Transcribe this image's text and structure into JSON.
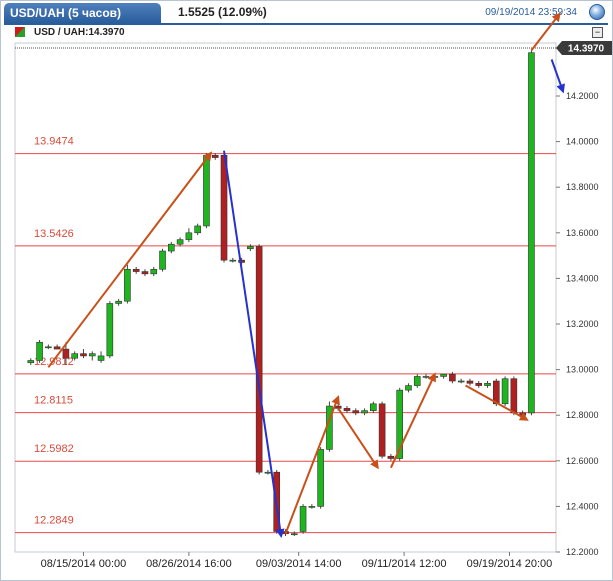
{
  "header": {
    "tab_title": "USD/UAH (5 часов)",
    "change": "1.5525 (12.09%)",
    "datetime": "09/19/2014 23:59:34",
    "symbol_label": "USD / UAH:14.3970",
    "current_price_label": "14.3970",
    "minimize_glyph": "−"
  },
  "chart_data": {
    "type": "candlestick",
    "xlim": [
      0,
      60
    ],
    "ylim": [
      12.2,
      14.45
    ],
    "y_ticks": [
      12.2,
      12.4,
      12.6,
      12.8,
      13.0,
      13.2,
      13.4,
      13.6,
      13.8,
      14.0,
      14.2
    ],
    "y_tick_labels": [
      "12.2000",
      "12.4000",
      "12.6000",
      "12.8000",
      "13.0000",
      "13.2000",
      "13.4000",
      "13.6000",
      "13.8000",
      "14.0000",
      "14.2000"
    ],
    "x_tick_labels": [
      {
        "x": 7,
        "label": "08/15/2014 00:00"
      },
      {
        "x": 19,
        "label": "08/26/2014 16:00"
      },
      {
        "x": 31.5,
        "label": "09/03/2014 14:00"
      },
      {
        "x": 43.5,
        "label": "09/11/2014 12:00"
      },
      {
        "x": 55.5,
        "label": "09/19/2014 20:00"
      }
    ],
    "last_price": 14.397,
    "levels": [
      {
        "value": 13.9474,
        "label": "13.9474"
      },
      {
        "value": 13.5426,
        "label": "13.5426"
      },
      {
        "value": 12.9812,
        "label": "12.9812"
      },
      {
        "value": 12.8115,
        "label": "12.8115"
      },
      {
        "value": 12.5982,
        "label": "12.5982"
      },
      {
        "value": 12.2849,
        "label": "12.2849"
      }
    ],
    "candles": [
      {
        "x": 1,
        "o": 13.03,
        "h": 13.05,
        "l": 13.02,
        "c": 13.04
      },
      {
        "x": 2,
        "o": 13.04,
        "h": 13.13,
        "l": 13.03,
        "c": 13.12
      },
      {
        "x": 3,
        "o": 13.1,
        "h": 13.11,
        "l": 13.09,
        "c": 13.1
      },
      {
        "x": 4,
        "o": 13.1,
        "h": 13.11,
        "l": 13.09,
        "c": 13.09
      },
      {
        "x": 5,
        "o": 13.09,
        "h": 13.12,
        "l": 13.02,
        "c": 13.05
      },
      {
        "x": 6,
        "o": 13.05,
        "h": 13.08,
        "l": 13.04,
        "c": 13.07
      },
      {
        "x": 7,
        "o": 13.07,
        "h": 13.09,
        "l": 13.05,
        "c": 13.06
      },
      {
        "x": 8,
        "o": 13.06,
        "h": 13.08,
        "l": 13.04,
        "c": 13.07
      },
      {
        "x": 9,
        "o": 13.04,
        "h": 13.08,
        "l": 13.03,
        "c": 13.06
      },
      {
        "x": 10,
        "o": 13.06,
        "h": 13.3,
        "l": 13.05,
        "c": 13.29
      },
      {
        "x": 11,
        "o": 13.29,
        "h": 13.31,
        "l": 13.28,
        "c": 13.3
      },
      {
        "x": 12,
        "o": 13.3,
        "h": 13.46,
        "l": 13.29,
        "c": 13.44
      },
      {
        "x": 13,
        "o": 13.44,
        "h": 13.45,
        "l": 13.42,
        "c": 13.43
      },
      {
        "x": 14,
        "o": 13.43,
        "h": 13.44,
        "l": 13.41,
        "c": 13.42
      },
      {
        "x": 15,
        "o": 13.42,
        "h": 13.45,
        "l": 13.41,
        "c": 13.44
      },
      {
        "x": 16,
        "o": 13.44,
        "h": 13.53,
        "l": 13.43,
        "c": 13.52
      },
      {
        "x": 17,
        "o": 13.52,
        "h": 13.56,
        "l": 13.51,
        "c": 13.55
      },
      {
        "x": 18,
        "o": 13.55,
        "h": 13.58,
        "l": 13.54,
        "c": 13.57
      },
      {
        "x": 19,
        "o": 13.57,
        "h": 13.62,
        "l": 13.56,
        "c": 13.6
      },
      {
        "x": 20,
        "o": 13.6,
        "h": 13.64,
        "l": 13.59,
        "c": 13.63
      },
      {
        "x": 21,
        "o": 13.63,
        "h": 13.95,
        "l": 13.62,
        "c": 13.94
      },
      {
        "x": 22,
        "o": 13.94,
        "h": 13.95,
        "l": 13.92,
        "c": 13.93
      },
      {
        "x": 23,
        "o": 13.94,
        "h": 13.95,
        "l": 13.47,
        "c": 13.48
      },
      {
        "x": 24,
        "o": 13.48,
        "h": 13.49,
        "l": 13.47,
        "c": 13.48
      },
      {
        "x": 25,
        "o": 13.48,
        "h": 13.49,
        "l": 13.46,
        "c": 13.47
      },
      {
        "x": 26,
        "o": 13.53,
        "h": 13.55,
        "l": 13.52,
        "c": 13.54
      },
      {
        "x": 27,
        "o": 13.54,
        "h": 13.55,
        "l": 12.54,
        "c": 12.55
      },
      {
        "x": 28,
        "o": 12.55,
        "h": 12.56,
        "l": 12.54,
        "c": 12.55
      },
      {
        "x": 29,
        "o": 12.55,
        "h": 12.56,
        "l": 12.28,
        "c": 12.29
      },
      {
        "x": 30,
        "o": 12.29,
        "h": 12.3,
        "l": 12.27,
        "c": 12.28
      },
      {
        "x": 31,
        "o": 12.28,
        "h": 12.29,
        "l": 12.27,
        "c": 12.28
      },
      {
        "x": 32,
        "o": 12.29,
        "h": 12.41,
        "l": 12.28,
        "c": 12.4
      },
      {
        "x": 33,
        "o": 12.4,
        "h": 12.41,
        "l": 12.39,
        "c": 12.4
      },
      {
        "x": 34,
        "o": 12.4,
        "h": 12.66,
        "l": 12.39,
        "c": 12.65
      },
      {
        "x": 35,
        "o": 12.65,
        "h": 12.86,
        "l": 12.64,
        "c": 12.84
      },
      {
        "x": 36,
        "o": 12.84,
        "h": 12.85,
        "l": 12.82,
        "c": 12.83
      },
      {
        "x": 37,
        "o": 12.83,
        "h": 12.84,
        "l": 12.81,
        "c": 12.82
      },
      {
        "x": 38,
        "o": 12.82,
        "h": 12.83,
        "l": 12.8,
        "c": 12.81
      },
      {
        "x": 39,
        "o": 12.81,
        "h": 12.83,
        "l": 12.8,
        "c": 12.82
      },
      {
        "x": 40,
        "o": 12.82,
        "h": 12.86,
        "l": 12.81,
        "c": 12.85
      },
      {
        "x": 41,
        "o": 12.85,
        "h": 12.86,
        "l": 12.61,
        "c": 12.62
      },
      {
        "x": 42,
        "o": 12.62,
        "h": 12.63,
        "l": 12.6,
        "c": 12.61
      },
      {
        "x": 43,
        "o": 12.61,
        "h": 12.92,
        "l": 12.6,
        "c": 12.91
      },
      {
        "x": 44,
        "o": 12.91,
        "h": 12.94,
        "l": 12.9,
        "c": 12.93
      },
      {
        "x": 45,
        "o": 12.93,
        "h": 12.98,
        "l": 12.92,
        "c": 12.97
      },
      {
        "x": 46,
        "o": 12.97,
        "h": 12.98,
        "l": 12.96,
        "c": 12.97
      },
      {
        "x": 47,
        "o": 12.97,
        "h": 12.98,
        "l": 12.96,
        "c": 12.97
      },
      {
        "x": 48,
        "o": 12.97,
        "h": 12.98,
        "l": 12.96,
        "c": 12.98
      },
      {
        "x": 49,
        "o": 12.98,
        "h": 12.99,
        "l": 12.94,
        "c": 12.95
      },
      {
        "x": 50,
        "o": 12.95,
        "h": 12.96,
        "l": 12.94,
        "c": 12.95
      },
      {
        "x": 51,
        "o": 12.95,
        "h": 12.96,
        "l": 12.93,
        "c": 12.94
      },
      {
        "x": 52,
        "o": 12.94,
        "h": 12.95,
        "l": 12.92,
        "c": 12.93
      },
      {
        "x": 53,
        "o": 12.93,
        "h": 12.95,
        "l": 12.92,
        "c": 12.94
      },
      {
        "x": 54,
        "o": 12.95,
        "h": 12.96,
        "l": 12.84,
        "c": 12.85
      },
      {
        "x": 55,
        "o": 12.85,
        "h": 12.97,
        "l": 12.84,
        "c": 12.96
      },
      {
        "x": 56,
        "o": 12.96,
        "h": 12.97,
        "l": 12.8,
        "c": 12.81
      },
      {
        "x": 57,
        "o": 12.81,
        "h": 12.82,
        "l": 12.79,
        "c": 12.8
      },
      {
        "x": 58,
        "o": 12.81,
        "h": 14.4,
        "l": 12.8,
        "c": 14.39
      }
    ],
    "annotation_arrows": [
      {
        "color": "#c8501a",
        "from": [
          3,
          13.01
        ],
        "to": [
          21.5,
          13.95
        ]
      },
      {
        "color": "#2432d0",
        "from": [
          23,
          13.96
        ],
        "to": [
          29.5,
          12.27
        ]
      },
      {
        "color": "#c8501a",
        "from": [
          30,
          12.28
        ],
        "to": [
          36,
          12.88
        ]
      },
      {
        "color": "#c8501a",
        "from": [
          36,
          12.83
        ],
        "to": [
          40.5,
          12.57
        ]
      },
      {
        "color": "#c8501a",
        "from": [
          42,
          12.57
        ],
        "to": [
          47,
          12.98
        ]
      },
      {
        "color": "#c8501a",
        "from": [
          50.5,
          12.93
        ],
        "to": [
          57.5,
          12.78
        ]
      },
      {
        "color": "#c8501a",
        "from": [
          58,
          14.4
        ],
        "to": [
          61.2,
          14.56
        ]
      },
      {
        "color": "#2432d0",
        "from": [
          60.3,
          14.36
        ],
        "to": [
          61.6,
          14.22
        ]
      }
    ],
    "colors": {
      "up": "#1fb51f",
      "down": "#b02020",
      "level_line": "#e84a4a",
      "level_text": "#d94a3a"
    },
    "grid": false,
    "legend": "none"
  }
}
